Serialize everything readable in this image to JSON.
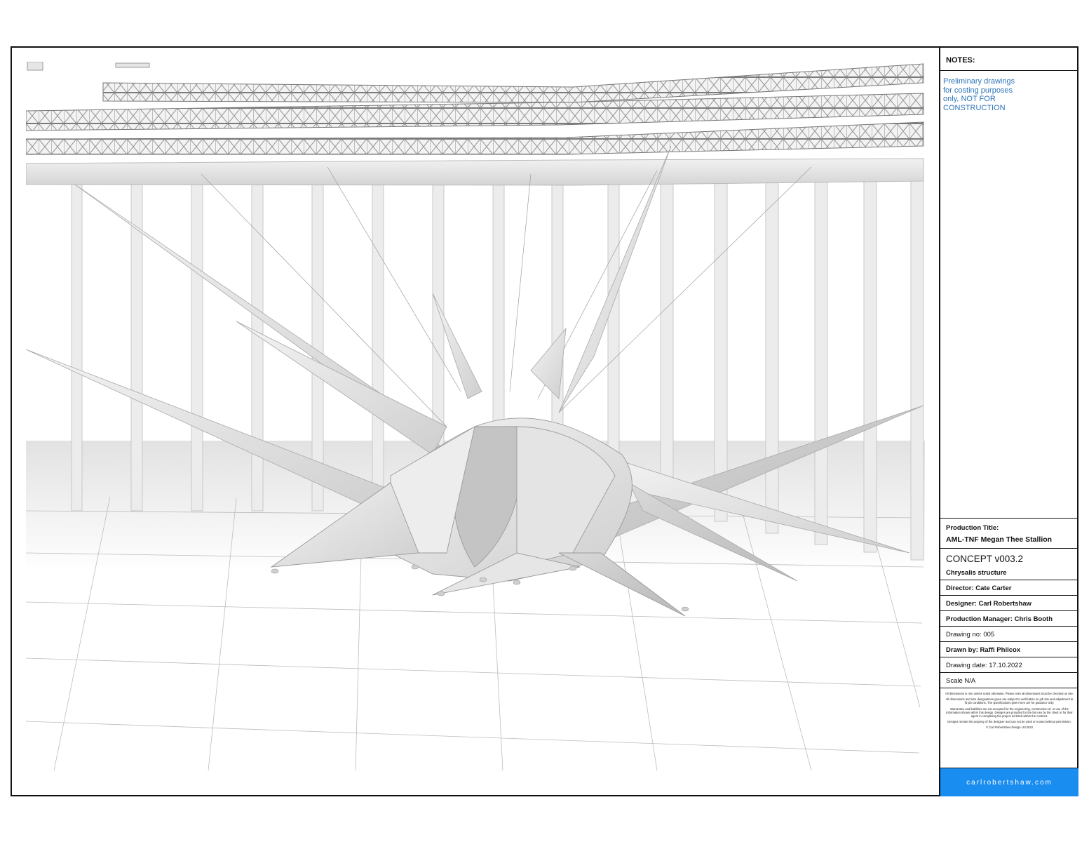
{
  "notes": {
    "heading": "NOTES:",
    "lines": [
      "Preliminary drawings",
      "for costing purposes",
      "only,  NOT FOR",
      "CONSTRUCTION"
    ],
    "color": "#2c73b8"
  },
  "title_block": {
    "production_title_label": "Production Title:",
    "production_title": "AML-TNF Megan Thee Stallion",
    "concept": "CONCEPT v003.2",
    "structure": "Chrysalis structure",
    "director": "Director: Cate Carter",
    "designer": "Designer: Carl Robertshaw",
    "production_manager": "Production Manager: Chris Booth",
    "drawing_no": "Drawing no: 005",
    "drawn_by": "Drawn by: Raffi Philcox",
    "drawing_date": "Drawing date: 17.10.2022",
    "scale": "Scale   N/A"
  },
  "disclaimer": {
    "p1": "All dimensions in mm unless noted otherwise. Please note all dimensions must be checked on site.",
    "p2": "All dimensions and size designations given are subject to verification on job site and adjustment to fit job conditions. The specifications given here are for guidance only.",
    "p3": "Warranties and liabilities are not accepted for the engineering, construction of, or use of the information shown within this design. Designs are provided for the fair use by the client or for their agent in completing the project as listed within the contract.",
    "p4": "Designs remain the property of the designer and can not be used  or reused without permission.",
    "p5": "© Carl Robertshaw Design Ltd  2022"
  },
  "website": "carlrobertshaw.com",
  "colors": {
    "accent": "#1a8df0",
    "notes_text": "#2c73b8",
    "border": "#111111"
  }
}
